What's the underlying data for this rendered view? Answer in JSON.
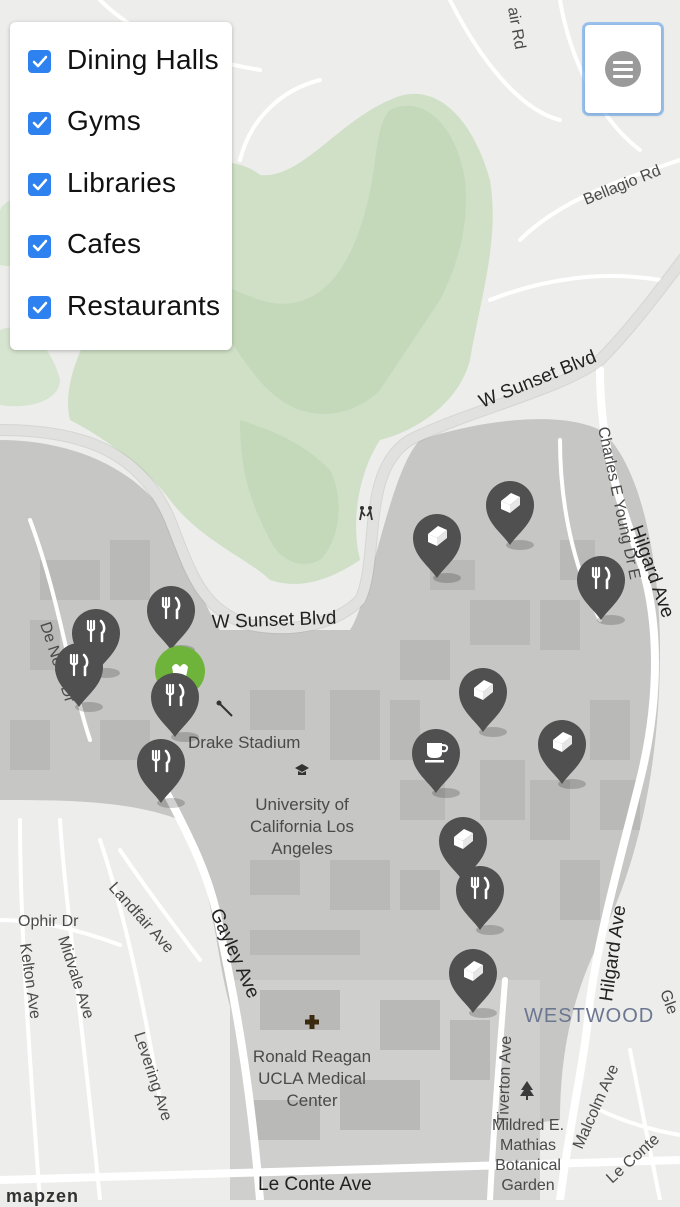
{
  "filters": [
    {
      "label": "Dining Halls",
      "checked": true
    },
    {
      "label": "Gyms",
      "checked": true
    },
    {
      "label": "Libraries",
      "checked": true
    },
    {
      "label": "Cafes",
      "checked": true
    },
    {
      "label": "Restaurants",
      "checked": true
    }
  ],
  "menu_icon": "hamburger-menu-icon",
  "map_labels": {
    "sunset_upper": "W Sunset Blvd",
    "sunset_lower": "W Sunset Blvd",
    "bellagio": "Bellagio Rd",
    "air_rd": "air Rd",
    "charles_young": "Charles E Young Dr E",
    "hilgard_upper": "Hilgard Ave",
    "hilgard_lower": "Hilgard Ave",
    "de_neve": "De Neve Dr",
    "drake_stadium": "Drake Stadium",
    "ucla_line1": "University of",
    "ucla_line2": "California Los",
    "ucla_line3": "Angeles",
    "landfair": "Landfair Ave",
    "ophir": "Ophir Dr",
    "midvale": "Midvale Ave",
    "kelton": "Kelton Ave",
    "gayley": "Gayley Ave",
    "levering": "Levering Ave",
    "ronald_line1": "Ronald Reagan",
    "ronald_line2": "UCLA Medical",
    "ronald_line3": "Center",
    "westwood": "WESTWOOD",
    "tiverton": "Tiverton Ave",
    "malcolm": "Malcolm Ave",
    "le_conte": "Le Conte Ave",
    "glen": "Gle",
    "mildred_line1": "Mildred E.",
    "mildred_line2": "Mathias",
    "mildred_line3": "Botanical",
    "mildred_line4": "Garden",
    "le_conte_right": "Le Conte"
  },
  "markers": [
    {
      "type": "library",
      "icon": "book-icon"
    },
    {
      "type": "library",
      "icon": "book-icon"
    },
    {
      "type": "restaurant",
      "icon": "fork-knife-icon"
    },
    {
      "type": "restaurant",
      "icon": "fork-knife-icon"
    },
    {
      "type": "restaurant",
      "icon": "fork-knife-icon"
    },
    {
      "type": "restaurant",
      "icon": "fork-knife-icon"
    },
    {
      "type": "gym",
      "icon": "gym-icon"
    },
    {
      "type": "restaurant",
      "icon": "fork-knife-icon"
    },
    {
      "type": "restaurant",
      "icon": "fork-knife-icon"
    },
    {
      "type": "library",
      "icon": "book-icon"
    },
    {
      "type": "cafe",
      "icon": "coffee-cup-icon"
    },
    {
      "type": "library",
      "icon": "book-icon"
    },
    {
      "type": "library",
      "icon": "book-icon"
    },
    {
      "type": "restaurant",
      "icon": "fork-knife-icon"
    },
    {
      "type": "library",
      "icon": "book-icon"
    }
  ],
  "attribution": "mapzen",
  "colors": {
    "checkbox": "#2d82f0",
    "marker": "#505050",
    "gym_marker": "#6fb43a",
    "park": "#cfe2c5",
    "campus": "#c7c7c5"
  }
}
